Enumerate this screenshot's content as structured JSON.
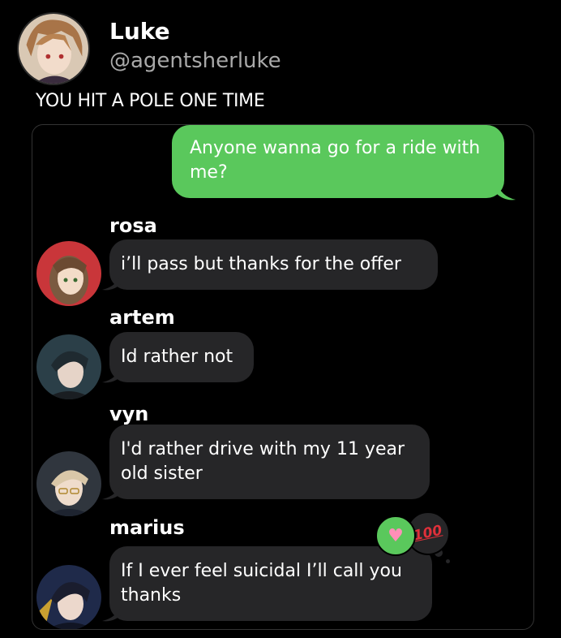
{
  "post": {
    "author_name": "Luke",
    "author_handle": "@agentsherluke",
    "text": "YOU HIT A POLE ONE TIME"
  },
  "chat": {
    "outgoing_message": "Anyone wanna go for a ride with me?",
    "messages": [
      {
        "sender": "rosa",
        "text": "i’ll pass but thanks for the offer"
      },
      {
        "sender": "artem",
        "text": "Id rather not"
      },
      {
        "sender": "vyn",
        "text": "I'd rather drive with my 11 year old sister"
      },
      {
        "sender": "marius",
        "text": "If I ever feel suicidal I’ll call you thanks"
      }
    ],
    "reactions": [
      {
        "name": "heart-reaction",
        "glyph": "♥",
        "color": "#5ac85c"
      },
      {
        "name": "hundred-reaction",
        "glyph": "100",
        "color": "#e0303a"
      }
    ]
  },
  "colors": {
    "background": "#000000",
    "outgoing_bubble": "#5ac85c",
    "incoming_bubble": "#262628",
    "handle_text": "#a9a9a9"
  }
}
